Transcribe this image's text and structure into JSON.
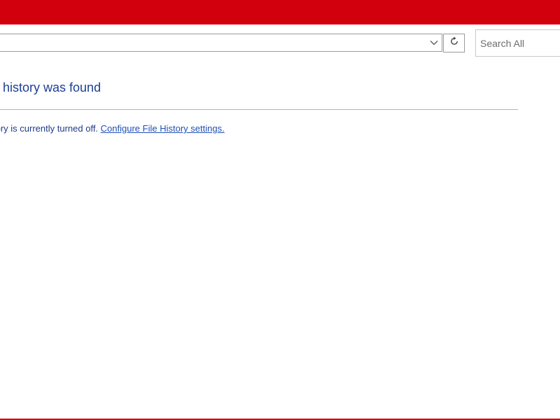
{
  "address": {
    "value": "",
    "dropdown_icon": "chevron-down-icon"
  },
  "toolbar": {
    "refresh_icon": "refresh-icon"
  },
  "search": {
    "placeholder": "Search All"
  },
  "content": {
    "heading": "e history was found",
    "message_prefix": "tory is currently turned off. ",
    "link_text": "Configure File History settings."
  },
  "colors": {
    "titlebar": "#d2000d",
    "heading": "#1c3f94",
    "link": "#1f4fb8"
  }
}
